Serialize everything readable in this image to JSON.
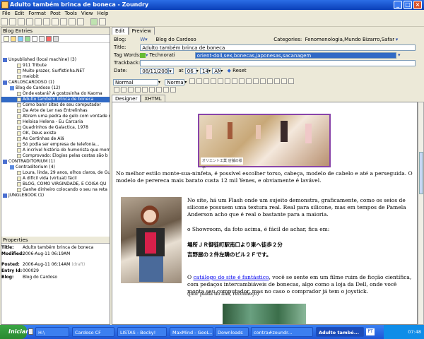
{
  "window": {
    "title": "Adulto também brinca de boneca - Zoundry"
  },
  "menu": [
    "File",
    "Edit",
    "Format",
    "Post",
    "Tools",
    "View",
    "Help"
  ],
  "left": {
    "header": "Blog Entries",
    "tree": [
      {
        "label": "Unpublished (local machine) (3)",
        "indent": 0
      },
      {
        "label": "911 Tribute",
        "indent": 2
      },
      {
        "label": "Muito prazer, Surfistinha.NET",
        "indent": 2
      },
      {
        "label": "meiobit",
        "indent": 2
      },
      {
        "label": "CARLOSCARDOSO (1)",
        "indent": 0
      },
      {
        "label": "Blog do Cardoso (12)",
        "indent": 1
      },
      {
        "label": "Onde estará? A gostosinha do Kaoma",
        "indent": 2
      },
      {
        "label": "Adulto também brinca de boneca",
        "indent": 2,
        "selected": true
      },
      {
        "label": "Como banir sites de seu computador",
        "indent": 2
      },
      {
        "label": "Da Arte de Ler nas Entrelinhas",
        "indent": 2
      },
      {
        "label": "Atirem uma pedra de gelo com vontade n",
        "indent": 2
      },
      {
        "label": "Heloisa Helena - Eu Carcaria",
        "indent": 2
      },
      {
        "label": "Quadrinhos de Galactica, 1978",
        "indent": 2
      },
      {
        "label": "OK, Deus existe",
        "indent": 2
      },
      {
        "label": "As Certinhas de Alá",
        "indent": 2
      },
      {
        "label": "Só podia ser empresa de telefonia...",
        "indent": 2
      },
      {
        "label": "A incrível história do humorista que morre",
        "indent": 2
      },
      {
        "label": "Comprovado: Elogios pelas costas são b",
        "indent": 2
      },
      {
        "label": "CONTRADITORIUM (1)",
        "indent": 0
      },
      {
        "label": "Contraditorium (4)",
        "indent": 1
      },
      {
        "label": "Loura, linda, 29 anos, olhos claros, de Gu",
        "indent": 2
      },
      {
        "label": "A difícil vida (virtual) fácil",
        "indent": 2
      },
      {
        "label": "BLOG, COMO VIRGINDADE, É COISA QU",
        "indent": 2
      },
      {
        "label": "Ganhe dinheiro colocando o seu na reta",
        "indent": 2
      },
      {
        "label": "JUNGLEBOOK (1)",
        "indent": 0
      }
    ],
    "props_header": "Properties",
    "props": [
      {
        "k": "Title:",
        "v": "Adulto também brinca de boneca"
      },
      {
        "k": "Modified:",
        "v": "2006-Aug-11 06:19AM"
      },
      {
        "k": "Posted:",
        "v": "2006-Aug-11 06:14AM",
        "extra": "(draft)"
      },
      {
        "k": "Entry Id:",
        "v": "000029"
      },
      {
        "k": "Blog:",
        "v": "Blog do Cardoso"
      }
    ]
  },
  "tabs": [
    "Edit",
    "Preview"
  ],
  "form": {
    "blog_label": "Blog:",
    "blog_value": "Blog do Cardoso",
    "categories_label": "Categories:",
    "categories_value": "Fenomenologia,Mundo Bizarro,Safardanagem",
    "title_label": "Title:",
    "title_value": "Adulto também brinca de boneca",
    "tagwords_label": "Tag Words:",
    "tag_service": "Technorati",
    "tags_value": "orient-doll,sex,bonecas,japonesas,sacanagem",
    "trackback_label": "Trackback:",
    "date_label": "Date:",
    "date_value": "08/11/2006",
    "hour_value": "06",
    "minute_value": "14",
    "ampm_value": "AM",
    "reset_label": "Reset"
  },
  "format": {
    "style": "Normal",
    "size": "Normal"
  },
  "design_tabs": [
    "Designer",
    "XHTML"
  ],
  "content": {
    "image_caption": "オリエント工業 店舗の様子",
    "p1": "No melhor estilo monte-sua-ninfeta, é possível escolher torso, cabeça, modelo de cabelo e até a perseguida. O modelo de perereca mais barato custa 12 mil Yenes, e obviamente é lavável.",
    "p2": "No site, há um Flash onde um sujeito demonstra, graficamente, como os seios de silicone possuem uma textura real. Real para silicone, mas em tempos de Pamela Anderson acho que é real o bastante para a maioria.",
    "p3": "o Showroom, da foto acima, é fácil de achar, fica em:",
    "jp1": "場所ＪＲ御徒町駅南口より東へ徒歩２分",
    "jp2": "吉野屋の２件左隣のビル２Ｆです。",
    "p4_pre": "O ",
    "p4_link": "catálogo do site é fantástico",
    "p4_post": ", você se sente em um filme ruim de ficção científica, com pedaços intercambiáveis de bonecas, algo como a loja da Dell, onde você monta seu computador, mas no caso o comprador já tem o joystick.",
    "p4_small": "(pior piada do ano, reconheço)"
  },
  "taskbar": {
    "start": "Iniciar",
    "items": [
      "H:\\",
      "Cardoso CF",
      "LISTAS - Becky!",
      "MaxMind - GeoL...",
      "Downloads",
      "contra#zoundr...",
      "Adulto també..."
    ],
    "lang": "PT",
    "clock": "07:48"
  },
  "colors": {
    "accent": "#316ac5",
    "titlebar": "#0a3fb8",
    "taskbar": "#1d56d6",
    "link": "#0000ee"
  }
}
